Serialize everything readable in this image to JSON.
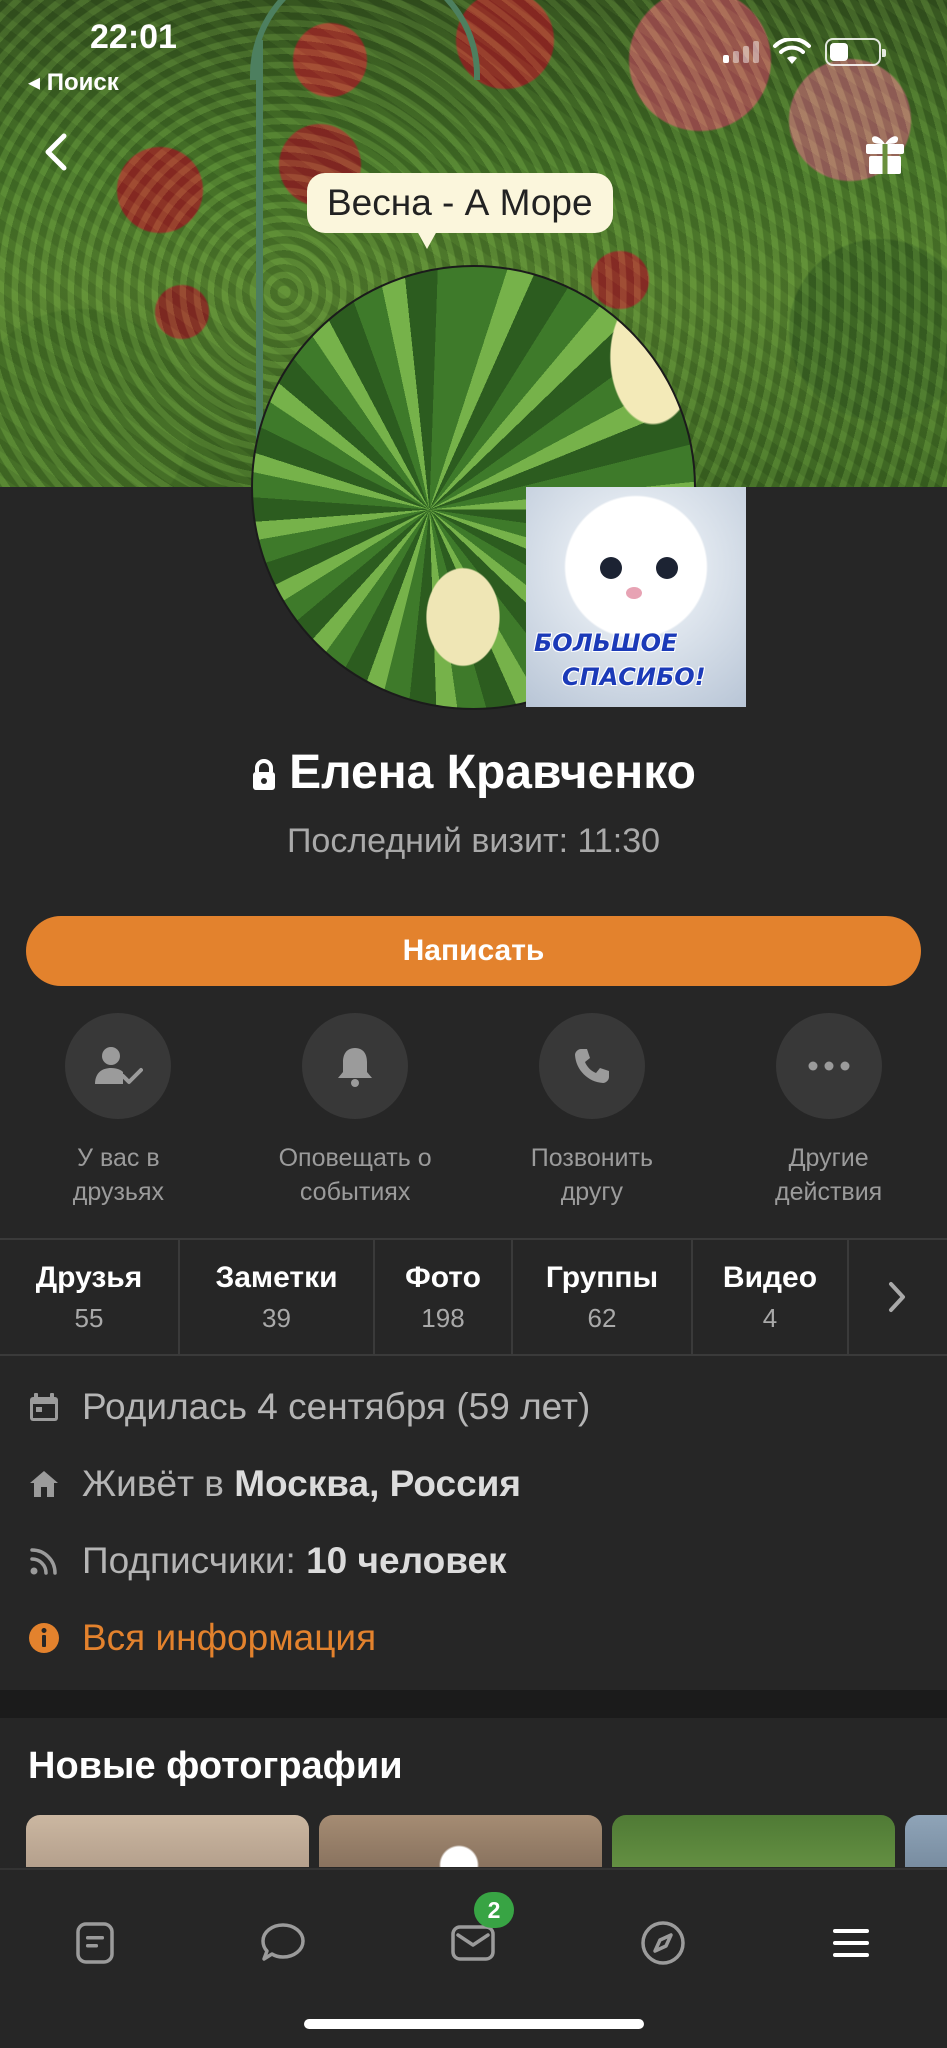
{
  "status_bar": {
    "time": "22:01",
    "back_label": "◂ Поиск",
    "battery_level": 0.4
  },
  "profile": {
    "status_text": "Весна - А Море",
    "sticker_line1": "БОЛЬШОЕ",
    "sticker_line2": "СПАСИБО!",
    "name": "Елена Кравченко",
    "last_visit": "Последний визит: 11:30"
  },
  "write_button": "Написать",
  "actions": [
    {
      "label": "У вас в друзьях",
      "icon": "friend-check-icon"
    },
    {
      "label": "Оповещать о событиях",
      "icon": "bell-icon"
    },
    {
      "label": "Позвонить другу",
      "icon": "phone-icon"
    },
    {
      "label": "Другие действия",
      "icon": "more-dots-icon"
    }
  ],
  "counters": [
    {
      "title": "Друзья",
      "count": "55"
    },
    {
      "title": "Заметки",
      "count": "39"
    },
    {
      "title": "Фото",
      "count": "198"
    },
    {
      "title": "Группы",
      "count": "62"
    },
    {
      "title": "Видео",
      "count": "4"
    }
  ],
  "info": {
    "birth": "Родилась 4 сентября (59 лет)",
    "lives_prefix": "Живёт в ",
    "lives_city": "Москва, Россия",
    "subs_prefix": "Подписчики: ",
    "subs_value": "10 человек",
    "all_info": "Вся информация"
  },
  "photos": {
    "title": "Новые фотографии"
  },
  "tabbar": {
    "messages_badge": "2"
  },
  "colors": {
    "accent": "#e3822d",
    "background": "#262626",
    "badge": "#38a444"
  }
}
